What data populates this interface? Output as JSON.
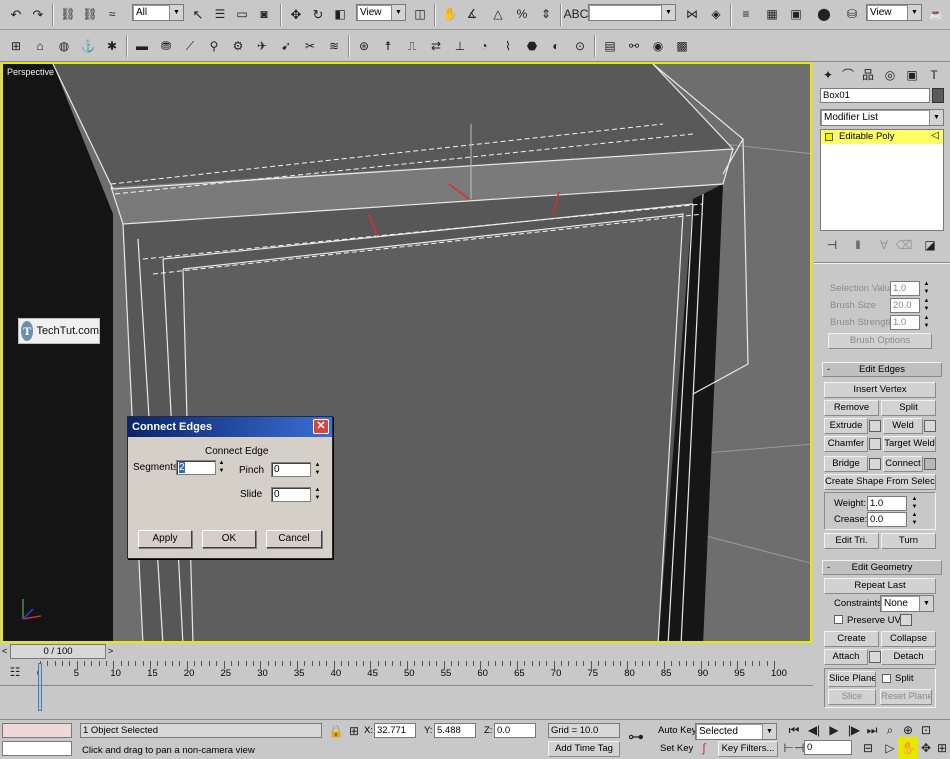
{
  "toolbar_main": {
    "selection_filter": "All",
    "ref_coord": "View",
    "named_selection": "",
    "view_dropdown": "View"
  },
  "viewport": {
    "label": "Perspective"
  },
  "watermark": {
    "logo_letter": "T",
    "text": "TechTut.com"
  },
  "dialog": {
    "title": "Connect Edges",
    "group_label": "Connect Edge",
    "segments_label": "Segments:",
    "segments_value": "2",
    "pinch_label": "Pinch",
    "pinch_value": "0",
    "slide_label": "Slide",
    "slide_value": "0",
    "apply_label": "Apply",
    "ok_label": "OK",
    "cancel_label": "Cancel"
  },
  "command_panel": {
    "object_name": "Box01",
    "modifier_list_label": "Modifier List",
    "stack_item": "Editable Poly",
    "soft_selection": {
      "selection_value_label": "Selection Value",
      "selection_value": "1.0",
      "brush_size_label": "Brush Size",
      "brush_size": "20.0",
      "brush_strength_label": "Brush Strength",
      "brush_strength": "1.0",
      "brush_options_label": "Brush Options"
    },
    "edit_edges": {
      "title": "Edit Edges",
      "insert_vertex": "Insert Vertex",
      "remove": "Remove",
      "split": "Split",
      "extrude": "Extrude",
      "weld": "Weld",
      "chamfer": "Chamfer",
      "target_weld": "Target Weld",
      "bridge": "Bridge",
      "connect": "Connect",
      "create_shape": "Create Shape From Selection",
      "weight_label": "Weight:",
      "weight_value": "1.0",
      "crease_label": "Crease:",
      "crease_value": "0.0",
      "edit_tri": "Edit Tri.",
      "turn": "Turn"
    },
    "edit_geometry": {
      "title": "Edit Geometry",
      "repeat_last": "Repeat Last",
      "constraints_label": "Constraints:",
      "constraints_value": "None",
      "preserve_uvs": "Preserve UVs",
      "create": "Create",
      "collapse": "Collapse",
      "attach": "Attach",
      "detach": "Detach",
      "slice_plane": "Slice Plane",
      "split": "Split",
      "slice": "Slice",
      "reset_plane": "Reset Plane"
    }
  },
  "timeline": {
    "frame_counter": "0 / 100",
    "ticks": [
      "0",
      "5",
      "10",
      "15",
      "20",
      "25",
      "30",
      "35",
      "40",
      "45",
      "50",
      "55",
      "60",
      "65",
      "70",
      "75",
      "80",
      "85",
      "90",
      "95",
      "100"
    ]
  },
  "status": {
    "selection_info": "1 Object Selected",
    "prompt": "Click and drag to pan a non-camera view",
    "x_label": "X:",
    "x_value": "32.771",
    "y_label": "Y:",
    "y_value": "5.488",
    "z_label": "Z:",
    "z_value": "0.0",
    "grid": "Grid = 10.0",
    "add_time_tag": "Add Time Tag",
    "auto_key": "Auto Key",
    "set_key": "Set Key",
    "key_mode": "Selected",
    "key_filters": "Key Filters...",
    "current_frame": "0"
  },
  "colors": {
    "viewport_border": "#e8e800",
    "stack_highlight": "#ffff66",
    "dialog_title": "#0a246a"
  }
}
